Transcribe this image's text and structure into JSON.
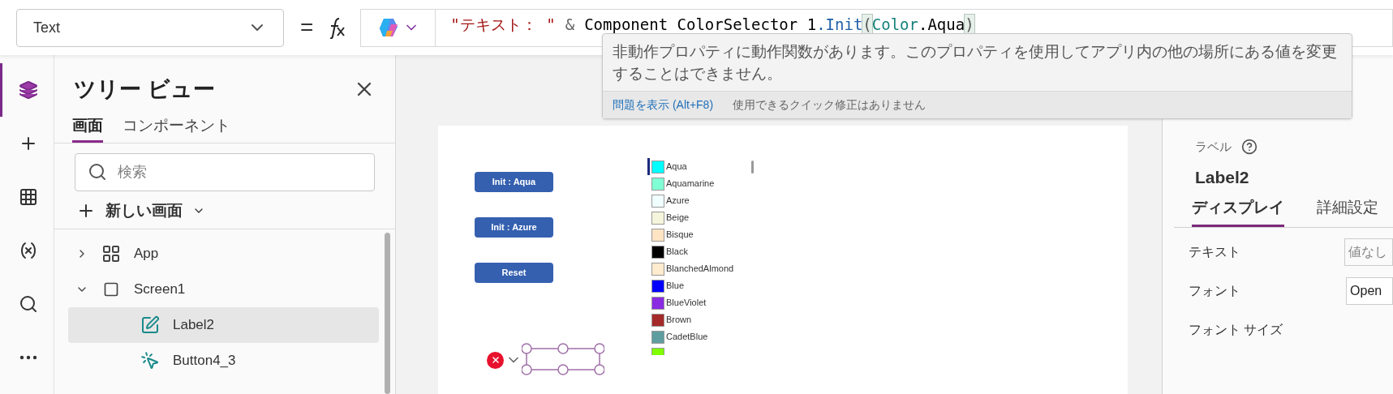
{
  "property_selector": {
    "value": "Text",
    "operator": "="
  },
  "formula": [
    {
      "kind": "string",
      "text": "\"テキスト： \""
    },
    {
      "kind": "operator",
      "text": "&"
    },
    {
      "kind": "identifier",
      "text": "Component ColorSelector 1"
    },
    {
      "kind": "function",
      "text": ".Init"
    },
    {
      "kind": "paren",
      "text": "("
    },
    {
      "kind": "enum",
      "text": "Color"
    },
    {
      "kind": "identifier",
      "text": ".Aqua"
    },
    {
      "kind": "paren",
      "text": ")"
    }
  ],
  "tooltip": {
    "message": "非動作プロパティに動作関数があります。このプロパティを使用してアプリ内の他の場所にある値を変更することはできません。",
    "link": "問題を表示 (Alt+F8)",
    "note": "使用できるクイック修正はありません"
  },
  "rail": [
    {
      "kind": "layers",
      "selected": true
    },
    {
      "kind": "insert",
      "selected": false
    },
    {
      "kind": "data",
      "selected": false
    },
    {
      "kind": "variables",
      "selected": false
    },
    {
      "kind": "search",
      "selected": false
    },
    {
      "kind": "more",
      "selected": false
    }
  ],
  "tree_view": {
    "title": "ツリー ビュー",
    "tabs": [
      {
        "label": "画面",
        "selected": true
      },
      {
        "label": "コンポーネント",
        "selected": false
      }
    ],
    "search": {
      "placeholder": "検索"
    },
    "new_screen": "新しい画面",
    "items": [
      {
        "kind": "app",
        "label": "App",
        "expanded": false,
        "selected": false
      },
      {
        "kind": "screen",
        "label": "Screen1",
        "expanded": true,
        "selected": false,
        "children": [
          {
            "kind": "label",
            "label": "Label2",
            "selected": true
          },
          {
            "kind": "button",
            "label": "Button4_3",
            "selected": false
          }
        ]
      }
    ]
  },
  "canvas": {
    "buttons": [
      "Init : Aqua",
      "Init : Azure",
      "Reset"
    ],
    "colors": [
      {
        "name": "Aqua",
        "color": "#00ffff",
        "selected": true
      },
      {
        "name": "Aquamarine",
        "color": "#7fffd4",
        "selected": false
      },
      {
        "name": "Azure",
        "color": "#f0ffff",
        "selected": false
      },
      {
        "name": "Beige",
        "color": "#f5f5dc",
        "selected": false
      },
      {
        "name": "Bisque",
        "color": "#ffe4c4",
        "selected": false
      },
      {
        "name": "Black",
        "color": "#000000",
        "selected": false
      },
      {
        "name": "BlanchedAlmond",
        "color": "#ffebcd",
        "selected": false
      },
      {
        "name": "Blue",
        "color": "#0000ff",
        "selected": false
      },
      {
        "name": "BlueViolet",
        "color": "#8a2be2",
        "selected": false
      },
      {
        "name": "Brown",
        "color": "#a52a2a",
        "selected": false
      },
      {
        "name": "CadetBlue",
        "color": "#5f9ea0",
        "selected": false
      },
      {
        "color": "#7fff00",
        "selected": false
      }
    ],
    "label_error": true
  },
  "properties": {
    "type": "ラベル",
    "name": "Label2",
    "tabs": [
      {
        "label": "ディスプレイ",
        "selected": true
      },
      {
        "label": "詳細設定",
        "selected": false
      }
    ],
    "rows": [
      {
        "label": "テキスト",
        "placeholder": "値なし"
      },
      {
        "label": "フォント",
        "value": "Open"
      },
      {
        "label": "フォント サイズ"
      }
    ]
  }
}
